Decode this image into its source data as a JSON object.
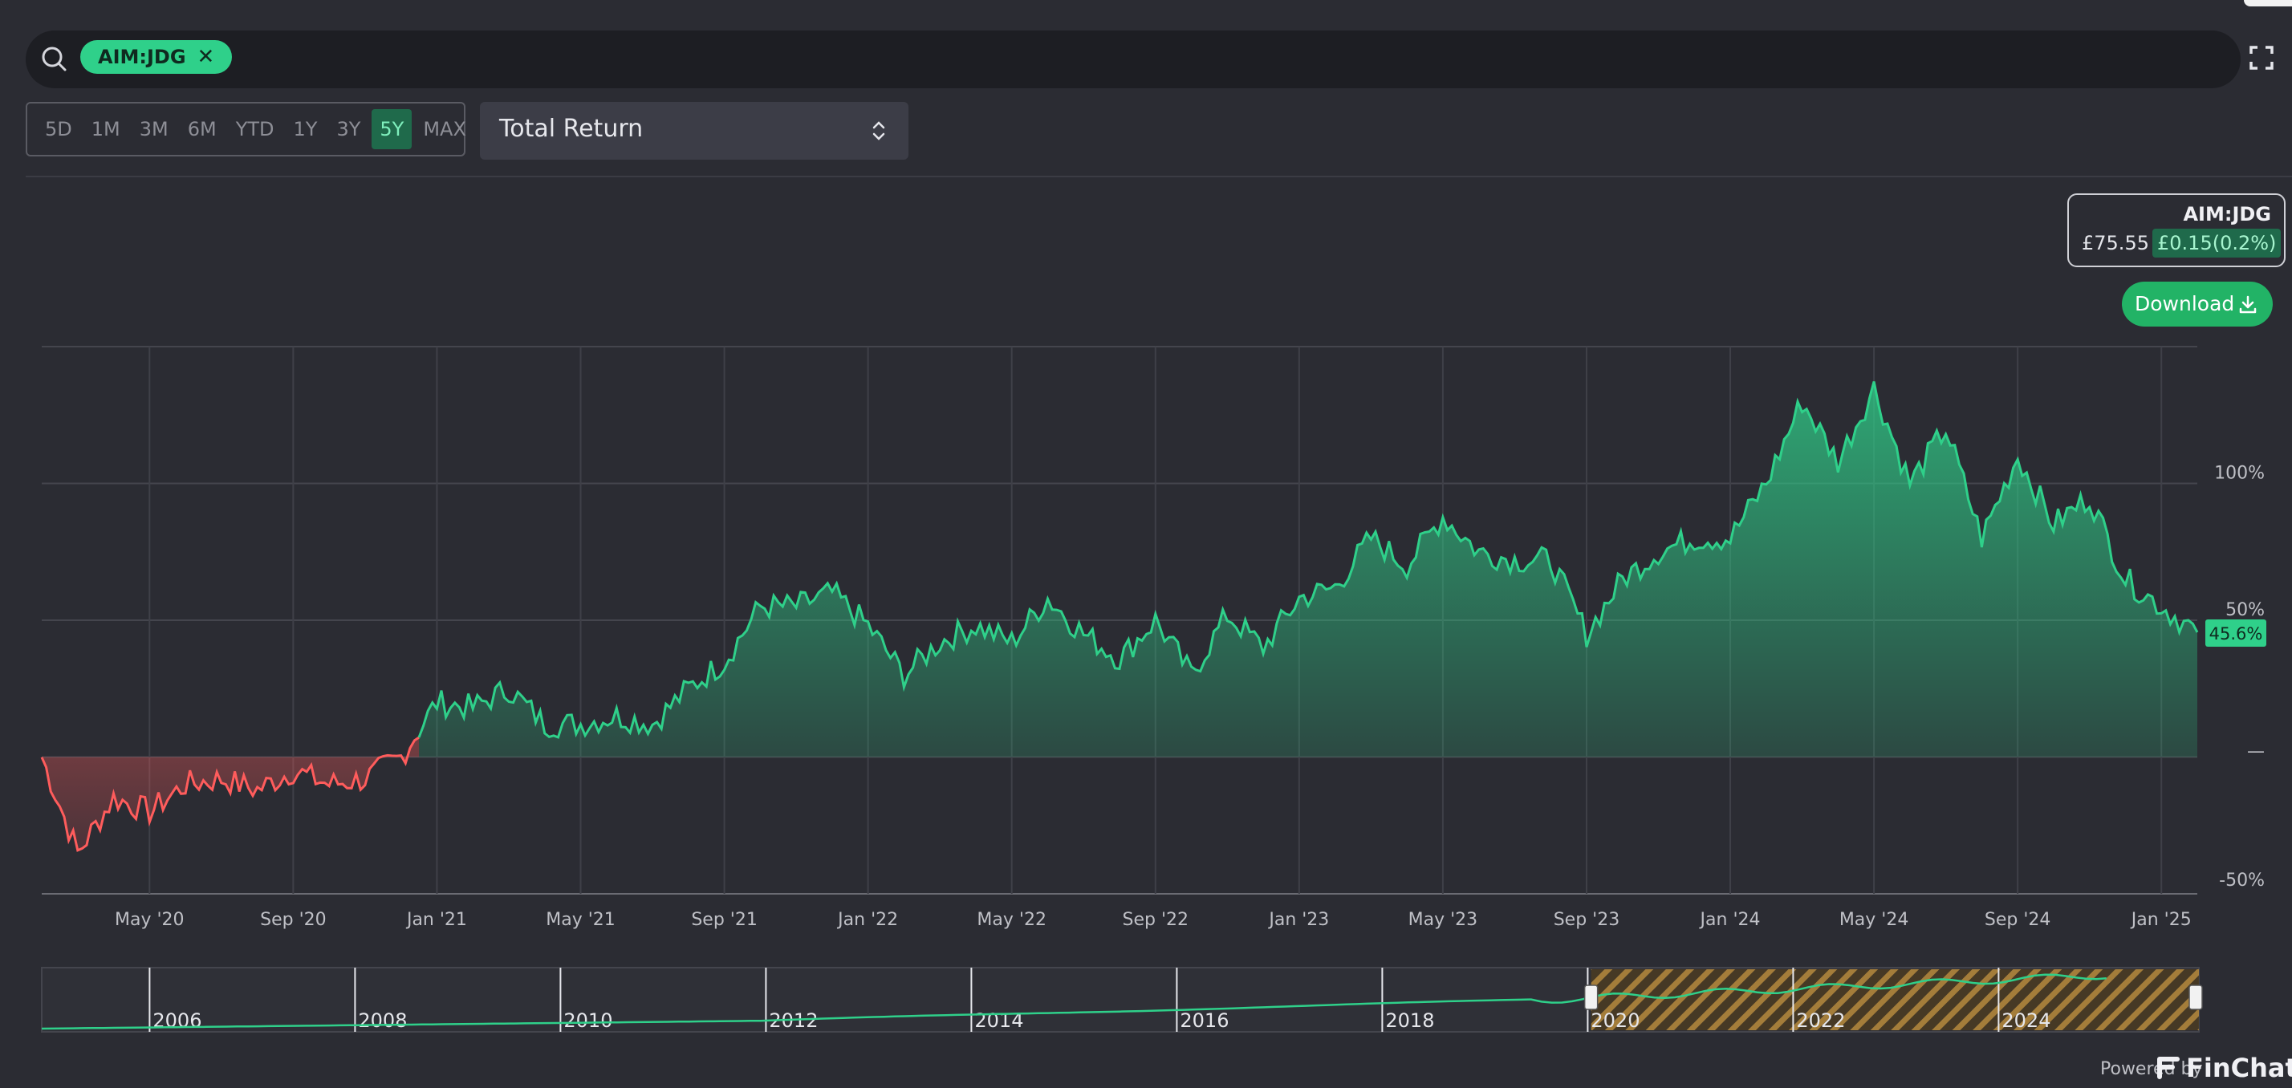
{
  "search": {
    "ticker_chip": "AIM:JDG",
    "close_glyph": "✕"
  },
  "toolbar": {
    "ranges": [
      "5D",
      "1M",
      "3M",
      "6M",
      "YTD",
      "1Y",
      "3Y",
      "5Y",
      "MAX"
    ],
    "active_range": "5Y",
    "metric": "Total Return"
  },
  "info": {
    "ticker": "AIM:JDG",
    "price": "£75.55",
    "change": "£0.15(0.2%)"
  },
  "download_label": "Download",
  "footer": {
    "powered_by": "Powered by",
    "brand": "FinChat"
  },
  "colors": {
    "positive": "#2fd08a",
    "negative": "#ff5c5c",
    "background": "#2b2c33",
    "accent_fill": "#1f6a4b"
  },
  "chart_data": {
    "type": "area",
    "title": "",
    "ylabel": "",
    "ylim": [
      -50,
      150
    ],
    "y_ticks": [
      "100%",
      "50%",
      "—",
      "-50%"
    ],
    "x_ticks": [
      "May '20",
      "Sep '20",
      "Jan '21",
      "May '21",
      "Sep '21",
      "Jan '22",
      "May '22",
      "Sep '22",
      "Jan '23",
      "May '23",
      "Sep '23",
      "Jan '24",
      "May '24",
      "Sep '24",
      "Jan '25"
    ],
    "last_value_label": "45.6%",
    "series": [
      {
        "x": [
          "2020-02",
          "2020-03",
          "2020-04",
          "2020-05",
          "2020-06",
          "2020-07",
          "2020-08",
          "2020-09",
          "2020-10",
          "2020-11",
          "2020-12",
          "2021-01",
          "2021-02",
          "2021-03",
          "2021-04",
          "2021-05",
          "2021-06",
          "2021-07",
          "2021-08",
          "2021-09",
          "2021-10",
          "2021-11",
          "2021-12",
          "2022-01",
          "2022-02",
          "2022-03",
          "2022-04",
          "2022-05",
          "2022-06",
          "2022-07",
          "2022-08",
          "2022-09",
          "2022-10",
          "2022-11",
          "2022-12",
          "2023-01",
          "2023-02",
          "2023-03",
          "2023-04",
          "2023-05",
          "2023-06",
          "2023-07",
          "2023-08",
          "2023-09",
          "2023-10",
          "2023-11",
          "2023-12",
          "2024-01",
          "2024-02",
          "2024-03",
          "2024-04",
          "2024-05",
          "2024-06",
          "2024-07",
          "2024-08",
          "2024-09",
          "2024-10",
          "2024-11",
          "2024-12",
          "2025-01",
          "2025-02"
        ],
        "values": [
          0,
          -35,
          -15,
          -20,
          -10,
          -8,
          -12,
          -5,
          -10,
          -8,
          0,
          20,
          18,
          25,
          12,
          12,
          15,
          12,
          25,
          35,
          55,
          55,
          60,
          48,
          30,
          42,
          48,
          42,
          58,
          45,
          36,
          50,
          30,
          52,
          40,
          58,
          62,
          80,
          70,
          88,
          75,
          72,
          72,
          45,
          65,
          75,
          80,
          80,
          100,
          130,
          108,
          135,
          100,
          120,
          80,
          110,
          85,
          95,
          65,
          55,
          45.6
        ]
      }
    ],
    "navigator": {
      "x_ticks": [
        "2006",
        "2008",
        "2010",
        "2012",
        "2014",
        "2016",
        "2018",
        "2020",
        "2022",
        "2024"
      ],
      "selected_from": "2020-02",
      "selected_to": "2025-02"
    }
  }
}
